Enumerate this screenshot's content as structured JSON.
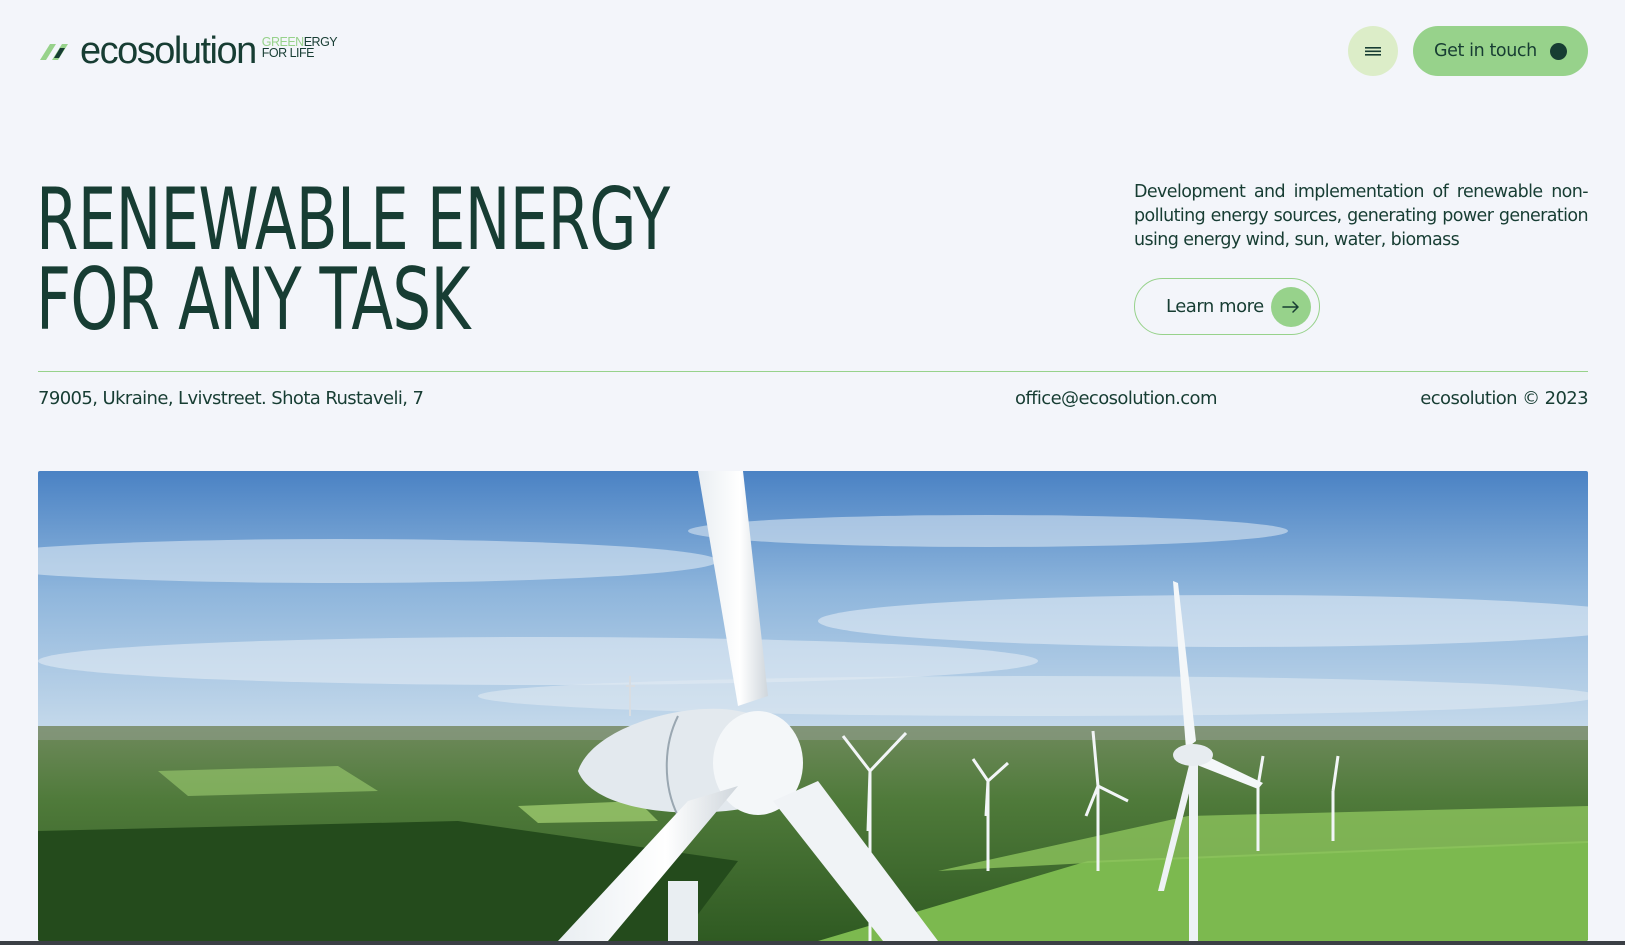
{
  "header": {
    "logo_text": "ecosolution",
    "logo_tag_green": "GREEN",
    "logo_tag_rest": "ERGY",
    "logo_tag_line2": "FOR LIFE",
    "menu_icon": "hamburger-icon",
    "cta_label": "Get in touch"
  },
  "hero": {
    "title_line1": "RENEWABLE ENERGY",
    "title_line2": "FOR ANY TASK",
    "description": "Development and implementation of renewable non-polluting energy sources, generating power generation using energy wind, sun, water, biomass",
    "learn_more_label": "Learn more",
    "learn_more_icon": "arrow-right-icon"
  },
  "info": {
    "address": "79005, Ukraine, Lvivstreet. Shota Rustaveli, 7",
    "email": "office@ecosolution.com",
    "copyright": "ecosolution © 2023"
  },
  "image": {
    "subject": "wind-turbines-landscape"
  },
  "colors": {
    "background": "#f3f5fa",
    "dark_green": "#173d33",
    "accent_green": "#97d28b",
    "light_green": "#dcedc8"
  }
}
